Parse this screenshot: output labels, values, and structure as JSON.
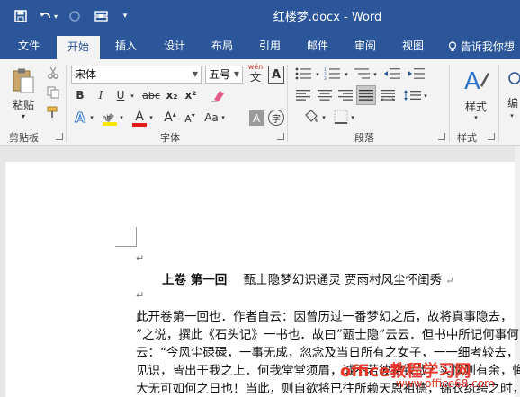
{
  "window": {
    "title": "红楼梦.docx - Word"
  },
  "qat": {
    "save_icon": "save-icon",
    "undo_icon": "undo-icon",
    "redo_icon": "redo-icon",
    "touch_icon": "touch-mode-icon",
    "customize_icon": "customize-qat-icon"
  },
  "tabs": [
    {
      "label": "文件"
    },
    {
      "label": "开始"
    },
    {
      "label": "插入"
    },
    {
      "label": "设计"
    },
    {
      "label": "布局"
    },
    {
      "label": "引用"
    },
    {
      "label": "邮件"
    },
    {
      "label": "审阅"
    },
    {
      "label": "视图"
    }
  ],
  "tell_me": "告诉我你想",
  "ribbon": {
    "clipboard": {
      "label": "剪贴板",
      "paste_label": "粘贴"
    },
    "font": {
      "label": "字体",
      "font_name": "宋体",
      "font_size": "五号",
      "phonetic": "wén",
      "bold": "B",
      "italic": "I",
      "underline": "U",
      "strike": "abc",
      "subscript": "x₂",
      "superscript": "x²",
      "text_effects": "A",
      "font_color_letter": "A",
      "grow_font": "A",
      "shrink_font": "A",
      "change_case": "Aa",
      "char_shading": "A",
      "enclose_char": "字"
    },
    "paragraph": {
      "label": "段落"
    },
    "styles": {
      "label": "样式",
      "button_label": "样式"
    },
    "editing": {
      "button_label": "编"
    },
    "colors": {
      "highlight": "#f7e600",
      "font_color": "#e41b1b",
      "accent": "#2b579a"
    }
  },
  "document": {
    "heading_bold": "上卷 第一回",
    "heading_rest": "甄士隐梦幻识通灵   贾雨村风尘怀闺秀",
    "lines": [
      "此开卷第一回也．作者自云：因曾历过一番梦幻之后，故将真事隐去，",
      "”之说，撰此《石头记》一书也．故曰”甄士隐”云云．但书中所记何事何",
      "云：“今风尘碌碌，一事无成，忽念及当日所有之女子，一一细考较去，",
      "见识，皆出于我之上．何我堂堂须眉，诚不若彼裙钗哉？实愧则有余，悔",
      "大无可如何之日也！当此，则自欲将已往所赖天恩祖德，锦衣纨绔之时，"
    ]
  },
  "watermark": {
    "text": "office教程学习网",
    "url": "www.office68.com"
  }
}
